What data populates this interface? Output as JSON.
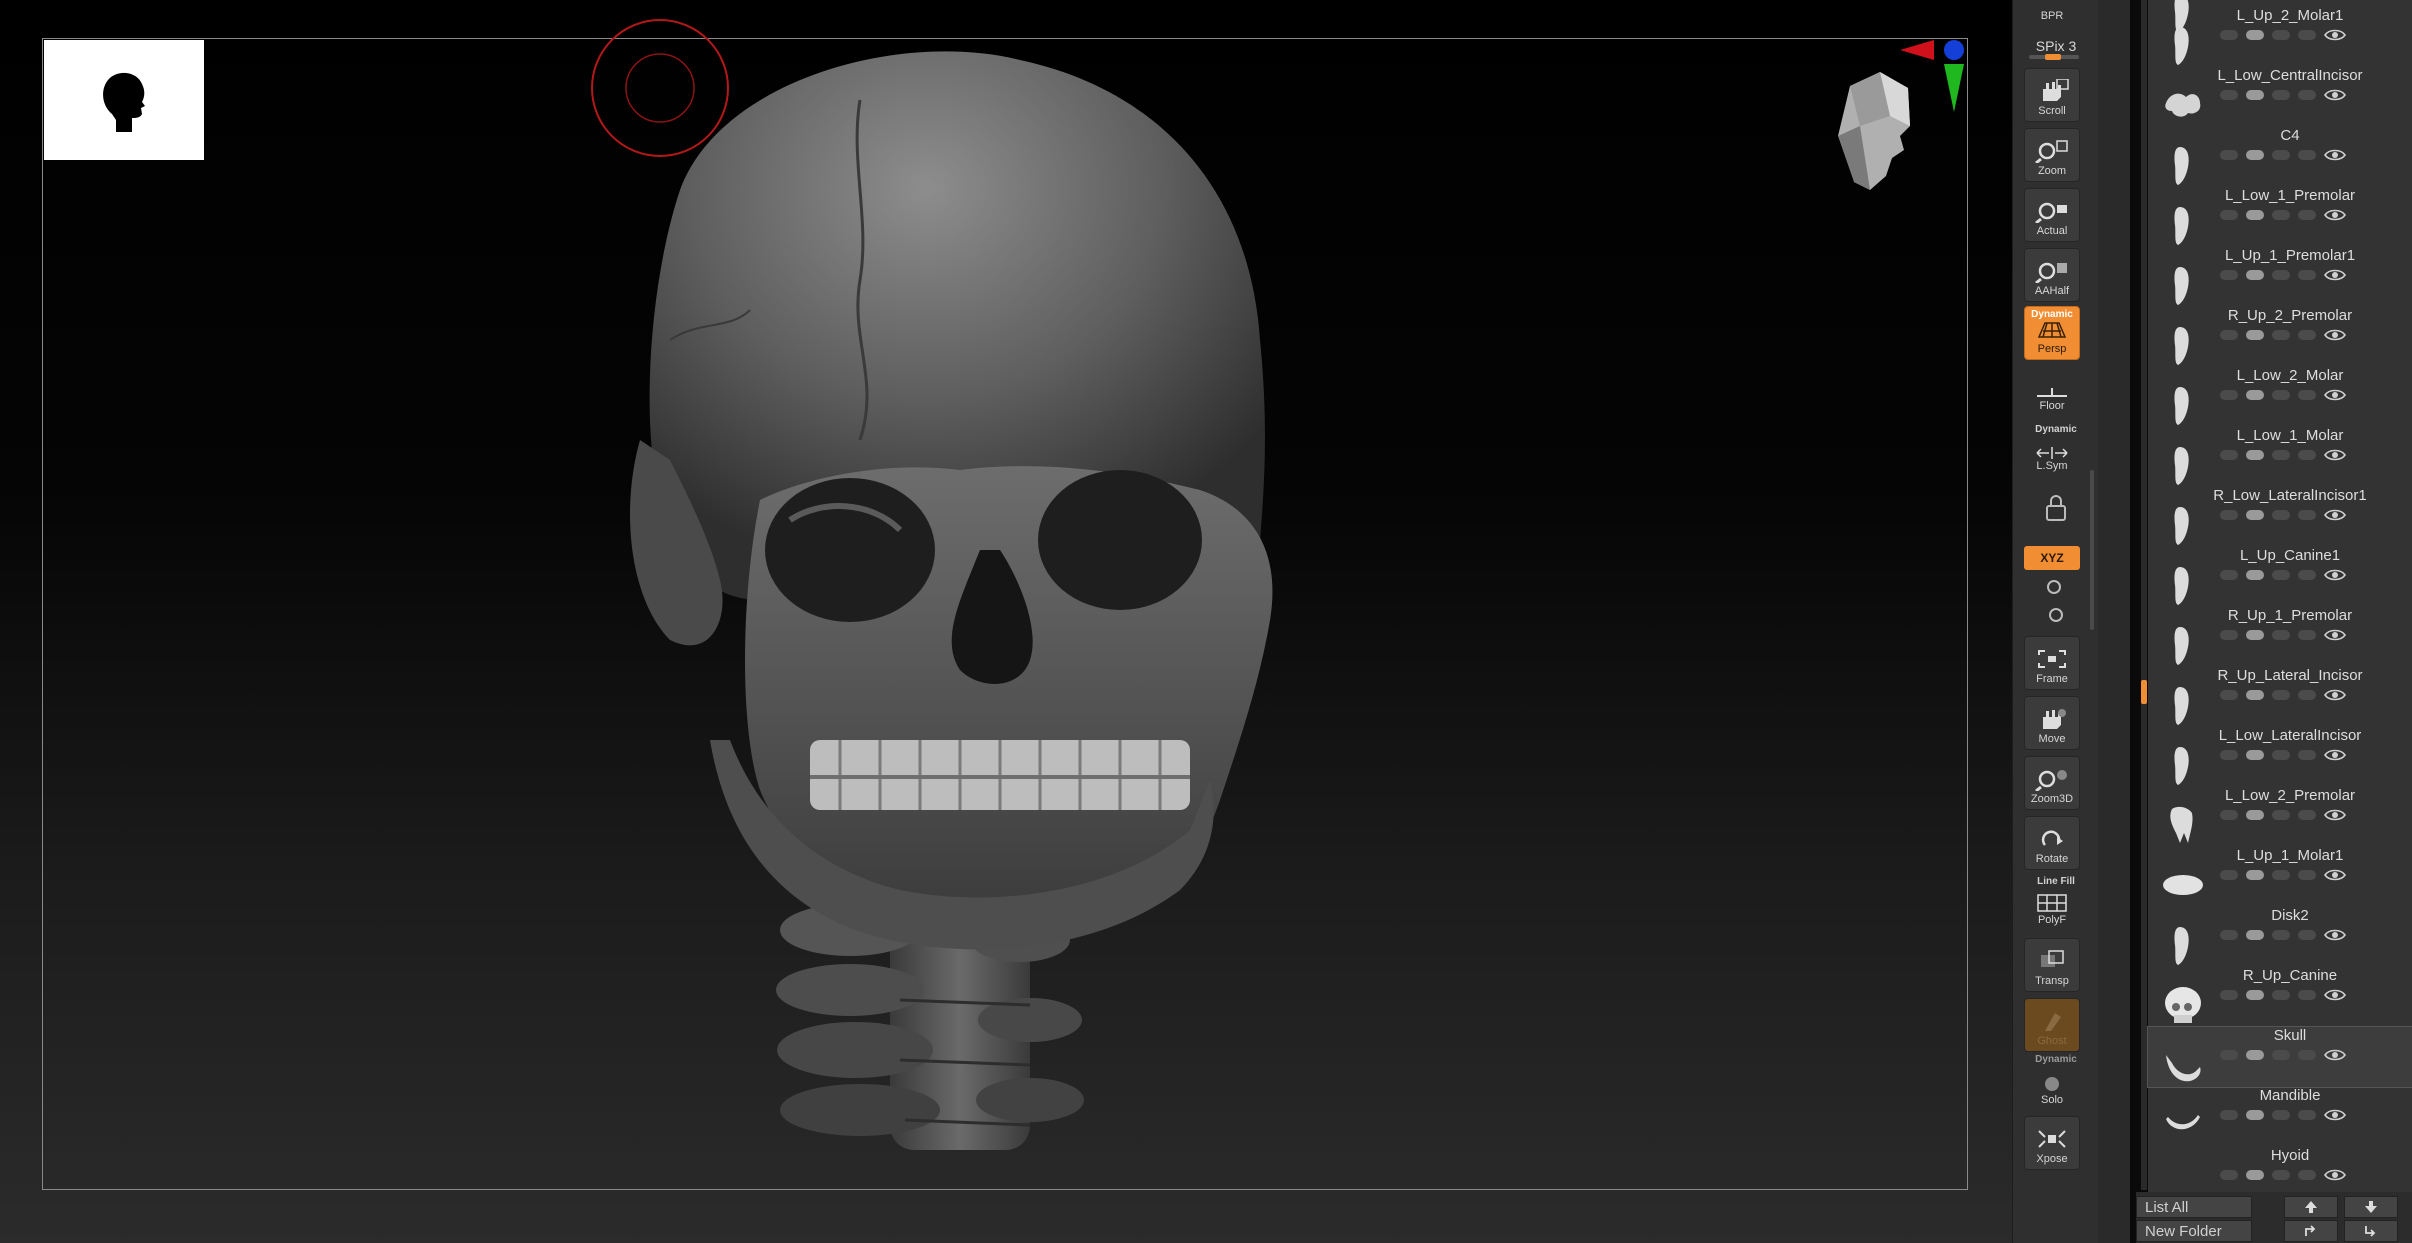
{
  "shelf": {
    "bpr_label": "BPR",
    "spix_label": "SPix 3",
    "scroll_label": "Scroll",
    "zoom_label": "Zoom",
    "actual_label": "Actual",
    "aahalf_label": "AAHalf",
    "persp_top": "Dynamic",
    "persp_label": "Persp",
    "floor_label": "Floor",
    "lsym_top": "Dynamic",
    "lsym_label": "L.Sym",
    "xyz_label": "XYZ",
    "frame_label": "Frame",
    "move_label": "Move",
    "zoom3d_label": "Zoom3D",
    "rotate_label": "Rotate",
    "polyf_top": "Line Fill",
    "polyf_label": "PolyF",
    "transp_label": "Transp",
    "ghost_label": "Ghost",
    "solo_top": "Dynamic",
    "solo_label": "Solo",
    "xpose_label": "Xpose"
  },
  "subtools": [
    {
      "name": "L_Up_2_Molar1",
      "shape": "tooth"
    },
    {
      "name": "L_Low_CentralIncisor",
      "shape": "tooth"
    },
    {
      "name": "C4",
      "shape": "vertebra"
    },
    {
      "name": "L_Low_1_Premolar",
      "shape": "tooth"
    },
    {
      "name": "L_Up_1_Premolar1",
      "shape": "tooth"
    },
    {
      "name": "R_Up_2_Premolar",
      "shape": "tooth"
    },
    {
      "name": "L_Low_2_Molar",
      "shape": "tooth"
    },
    {
      "name": "L_Low_1_Molar",
      "shape": "tooth"
    },
    {
      "name": "R_Low_LateralIncisor1",
      "shape": "tooth"
    },
    {
      "name": "L_Up_Canine1",
      "shape": "tooth"
    },
    {
      "name": "R_Up_1_Premolar",
      "shape": "tooth"
    },
    {
      "name": "R_Up_Lateral_Incisor",
      "shape": "tooth"
    },
    {
      "name": "L_Low_LateralIncisor",
      "shape": "tooth"
    },
    {
      "name": "L_Low_2_Premolar",
      "shape": "tooth"
    },
    {
      "name": "L_Up_1_Molar1",
      "shape": "molar"
    },
    {
      "name": "Disk2",
      "shape": "disk"
    },
    {
      "name": "R_Up_Canine",
      "shape": "tooth"
    },
    {
      "name": "Skull",
      "shape": "skull",
      "selected": true
    },
    {
      "name": "Mandible",
      "shape": "mandible"
    },
    {
      "name": "Hyoid",
      "shape": "hyoid"
    }
  ],
  "panel_bottom": {
    "list_all": "List All",
    "new_folder": "New Folder"
  },
  "colors": {
    "accent": "#f18d32",
    "panel": "#333333",
    "shelf": "#2f2f2f"
  }
}
